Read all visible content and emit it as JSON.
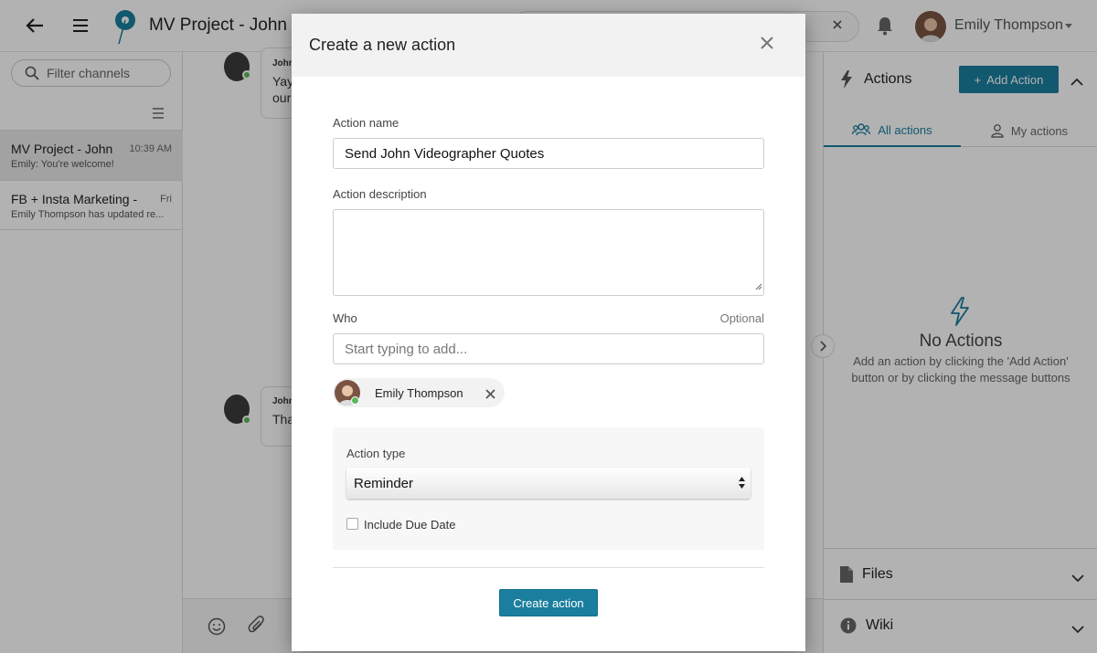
{
  "header": {
    "title": "MV Project - John",
    "user_name": "Emily Thompson"
  },
  "sidebar": {
    "filter_placeholder": "Filter channels",
    "channels": [
      {
        "name": "MV Project - John",
        "time": "10:39 AM",
        "preview": "Emily: You're welcome!"
      },
      {
        "name": "FB + Insta Marketing - ...",
        "time": "Fri",
        "preview": "Emily Thompson has updated re..."
      }
    ]
  },
  "chat": {
    "messages": [
      {
        "author": "John",
        "text": "Yay",
        "text2": "our"
      },
      {
        "author": "John",
        "text": "Tha"
      }
    ]
  },
  "actions_panel": {
    "title": "Actions",
    "add_label": "Add Action",
    "tabs": [
      "All actions",
      "My actions"
    ],
    "empty_title": "No Actions",
    "empty_line1": "Add an action by clicking the 'Add Action'",
    "empty_line2": "button or by clicking the message buttons",
    "sections": [
      "Files",
      "Wiki"
    ]
  },
  "modal": {
    "title": "Create a new action",
    "name_label": "Action name",
    "name_value": "Send John Videographer Quotes",
    "desc_label": "Action description",
    "who_label": "Who",
    "who_optional": "Optional",
    "who_placeholder": "Start typing to add...",
    "assignee": "Emily Thompson",
    "type_label": "Action type",
    "type_value": "Reminder",
    "due_label": "Include Due Date",
    "create_label": "Create action"
  },
  "colors": {
    "accent": "#1a7e9e",
    "online": "#5cb85c"
  }
}
